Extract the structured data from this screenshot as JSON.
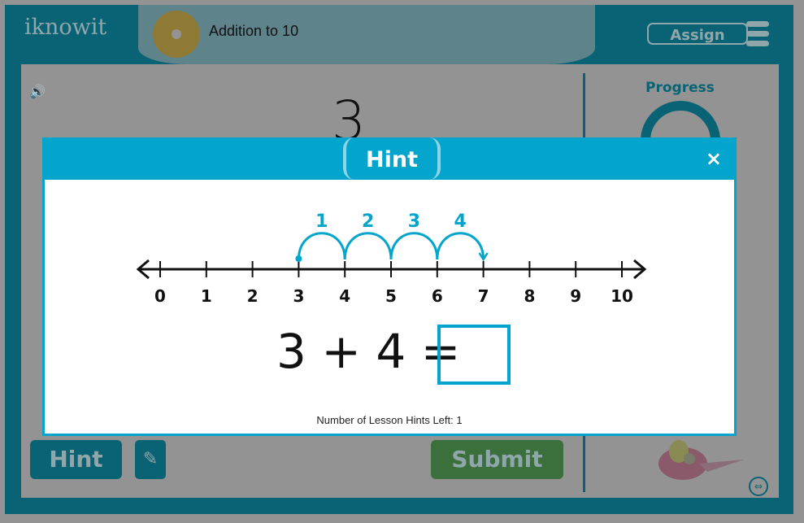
{
  "header": {
    "logo": "iknowit",
    "lesson_title": "Addition to 10",
    "assign_label": "Assign"
  },
  "question": {
    "number": "3"
  },
  "progress": {
    "label": "Progress"
  },
  "buttons": {
    "hint": "Hint",
    "submit": "Submit"
  },
  "modal": {
    "title": "Hint",
    "close": "×",
    "number_line": {
      "ticks": [
        "0",
        "1",
        "2",
        "3",
        "4",
        "5",
        "6",
        "7",
        "8",
        "9",
        "10"
      ],
      "start": 3,
      "jumps": [
        "1",
        "2",
        "3",
        "4"
      ],
      "color": "#03a5cd"
    },
    "equation": "3 + 4 =",
    "answer": "",
    "hints_left": "Number of Lesson Hints Left: 1"
  },
  "colors": {
    "frame": "#0a6374",
    "accent": "#03a5cd",
    "submit": "#3b6f3b"
  }
}
